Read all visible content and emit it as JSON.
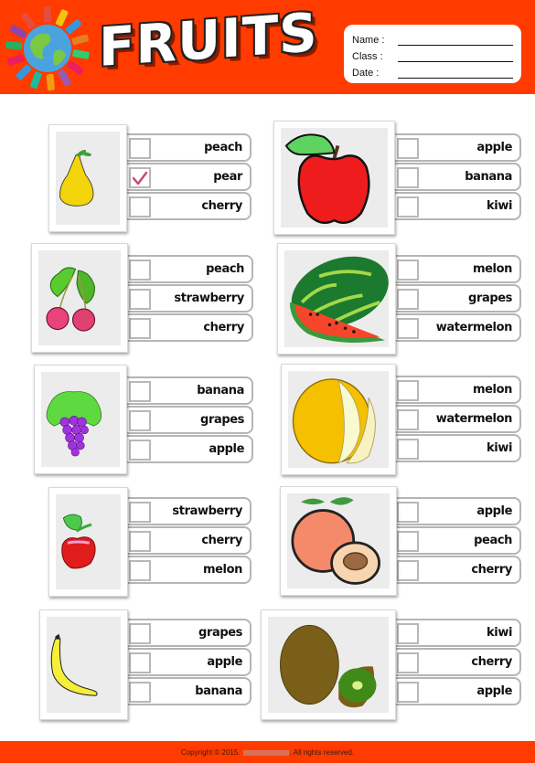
{
  "header": {
    "title": "FRUITS",
    "background_color": "#ff3b00",
    "fields": [
      {
        "label": "Name :",
        "value": ""
      },
      {
        "label": "Class :",
        "value": ""
      },
      {
        "label": "Date :",
        "value": ""
      }
    ]
  },
  "exercises": [
    {
      "fruit_image": "pear",
      "options": [
        {
          "label": "peach",
          "checked": false
        },
        {
          "label": "pear",
          "checked": true
        },
        {
          "label": "cherry",
          "checked": false
        }
      ]
    },
    {
      "fruit_image": "apple",
      "options": [
        {
          "label": "apple",
          "checked": false
        },
        {
          "label": "banana",
          "checked": false
        },
        {
          "label": "kiwi",
          "checked": false
        }
      ]
    },
    {
      "fruit_image": "cherry",
      "options": [
        {
          "label": "peach",
          "checked": false
        },
        {
          "label": "strawberry",
          "checked": false
        },
        {
          "label": "cherry",
          "checked": false
        }
      ]
    },
    {
      "fruit_image": "watermelon",
      "options": [
        {
          "label": "melon",
          "checked": false
        },
        {
          "label": "grapes",
          "checked": false
        },
        {
          "label": "watermelon",
          "checked": false
        }
      ]
    },
    {
      "fruit_image": "grapes",
      "options": [
        {
          "label": "banana",
          "checked": false
        },
        {
          "label": "grapes",
          "checked": false
        },
        {
          "label": "apple",
          "checked": false
        }
      ]
    },
    {
      "fruit_image": "melon",
      "options": [
        {
          "label": "melon",
          "checked": false
        },
        {
          "label": "watermelon",
          "checked": false
        },
        {
          "label": "kiwi",
          "checked": false
        }
      ]
    },
    {
      "fruit_image": "strawberry",
      "options": [
        {
          "label": "strawberry",
          "checked": false
        },
        {
          "label": "cherry",
          "checked": false
        },
        {
          "label": "melon",
          "checked": false
        }
      ]
    },
    {
      "fruit_image": "peach",
      "options": [
        {
          "label": "apple",
          "checked": false
        },
        {
          "label": "peach",
          "checked": false
        },
        {
          "label": "cherry",
          "checked": false
        }
      ]
    },
    {
      "fruit_image": "banana",
      "options": [
        {
          "label": "grapes",
          "checked": false
        },
        {
          "label": "apple",
          "checked": false
        },
        {
          "label": "banana",
          "checked": false
        }
      ]
    },
    {
      "fruit_image": "kiwi",
      "options": [
        {
          "label": "kiwi",
          "checked": false
        },
        {
          "label": "cherry",
          "checked": false
        },
        {
          "label": "apple",
          "checked": false
        }
      ]
    }
  ],
  "checkmark_color": "#c8457a",
  "footer": {
    "prefix": "Copyright © 2015.",
    "suffix": ". All rights reserved."
  }
}
